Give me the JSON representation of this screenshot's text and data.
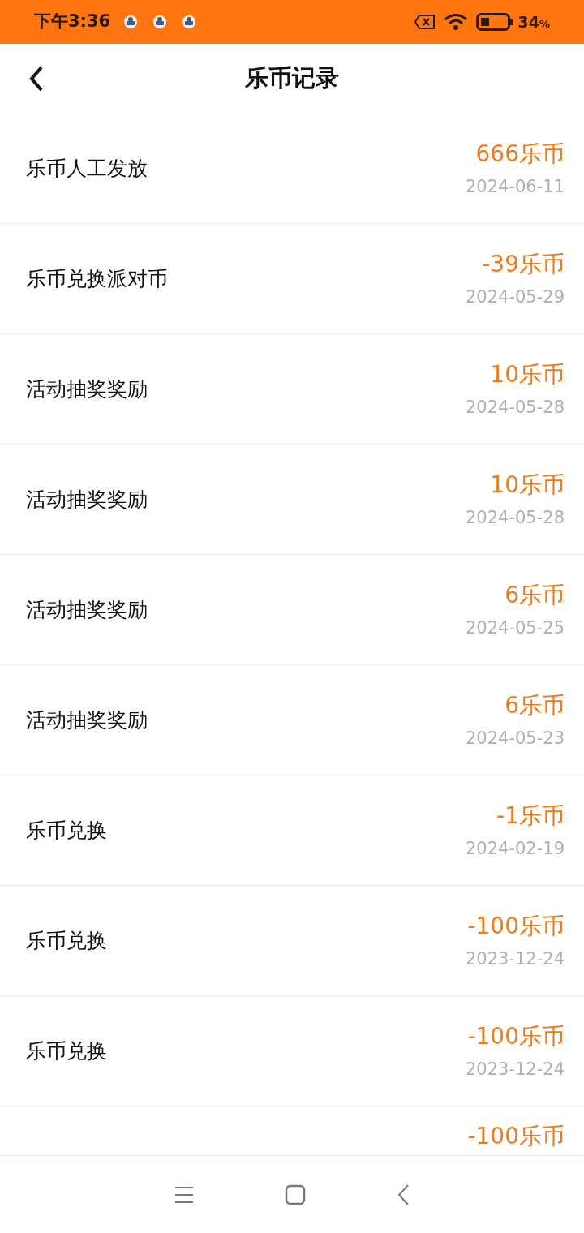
{
  "status_bar": {
    "time": "下午3:36",
    "battery": "34",
    "battery_unit": "%"
  },
  "header": {
    "title": "乐币记录"
  },
  "records": [
    {
      "title": "乐币人工发放",
      "amount": "666乐币",
      "date": "2024-06-11"
    },
    {
      "title": "乐币兑换派对币",
      "amount": "-39乐币",
      "date": "2024-05-29"
    },
    {
      "title": "活动抽奖奖励",
      "amount": "10乐币",
      "date": "2024-05-28"
    },
    {
      "title": "活动抽奖奖励",
      "amount": "10乐币",
      "date": "2024-05-28"
    },
    {
      "title": "活动抽奖奖励",
      "amount": "6乐币",
      "date": "2024-05-25"
    },
    {
      "title": "活动抽奖奖励",
      "amount": "6乐币",
      "date": "2024-05-23"
    },
    {
      "title": "乐币兑换",
      "amount": "-1乐币",
      "date": "2024-02-19"
    },
    {
      "title": "乐币兑换",
      "amount": "-100乐币",
      "date": "2023-12-24"
    },
    {
      "title": "乐币兑换",
      "amount": "-100乐币",
      "date": "2023-12-24"
    }
  ],
  "partial_record": {
    "amount": "-100乐币"
  }
}
